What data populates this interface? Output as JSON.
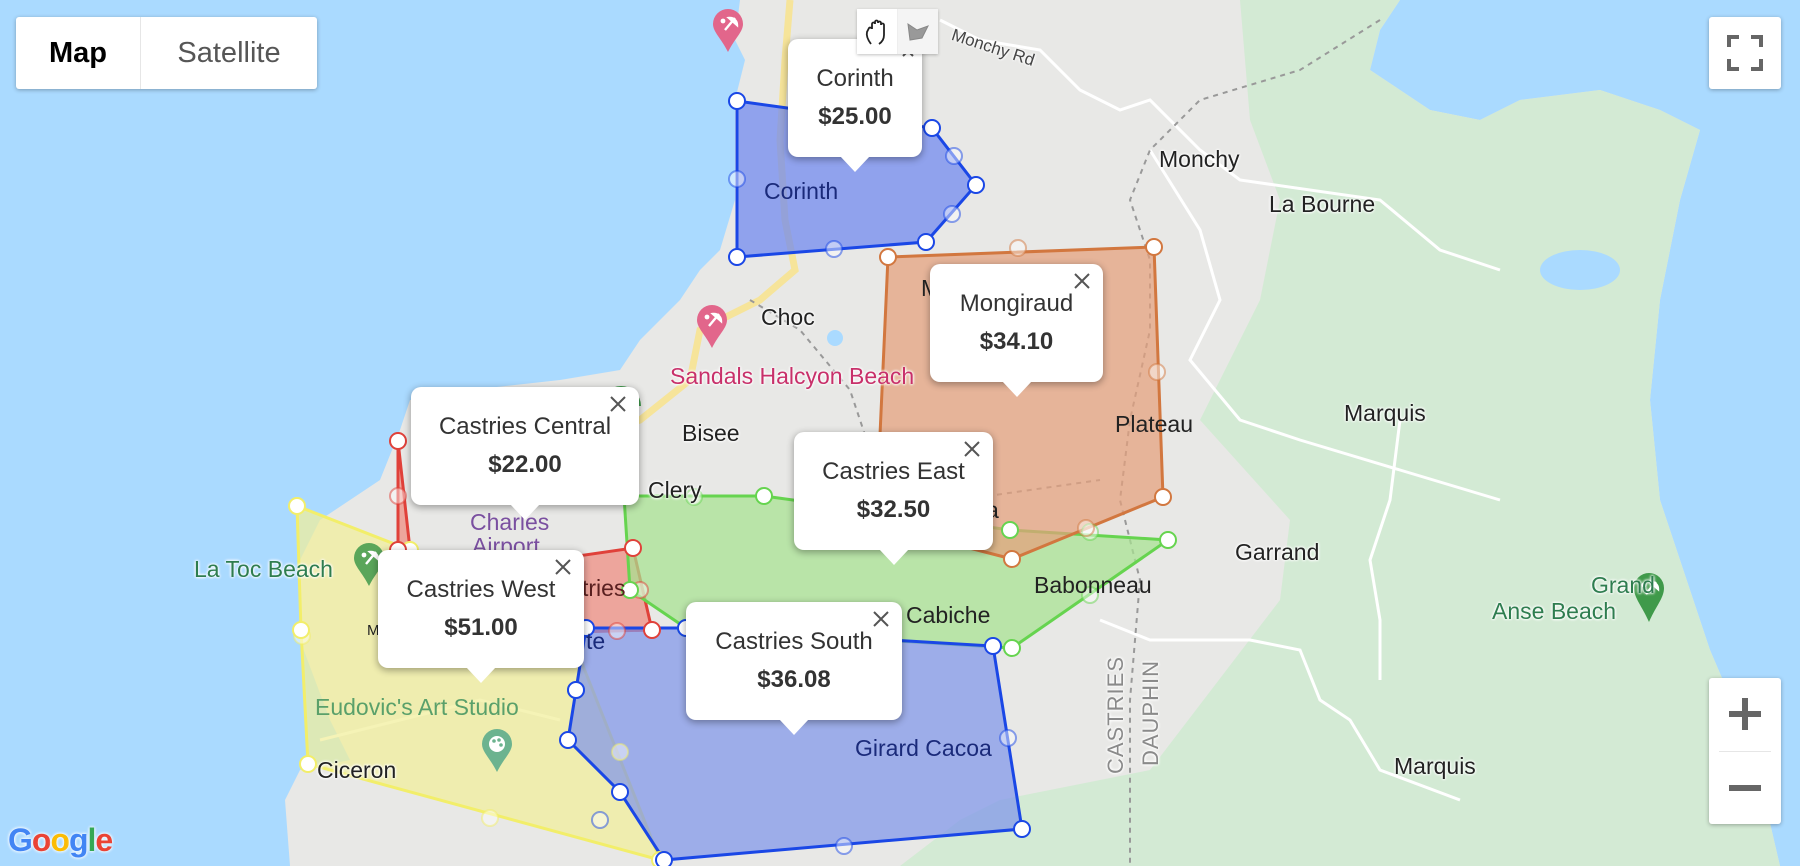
{
  "map_type": {
    "options": [
      "Map",
      "Satellite"
    ],
    "selected": "Map"
  },
  "controls": {
    "fullscreen": "fullscreen-icon",
    "zoom_in": "+",
    "zoom_out": "−",
    "drawing_tools": [
      "hand-pan-icon",
      "polygon-draw-icon"
    ]
  },
  "attribution": {
    "logo_letters": [
      "G",
      "o",
      "o",
      "g",
      "l",
      "e"
    ],
    "logo_colors": [
      "#4285f4",
      "#ea4335",
      "#fbbc05",
      "#4285f4",
      "#34a853",
      "#ea4335"
    ]
  },
  "zones": [
    {
      "name": "Corinth",
      "price": "$25.00",
      "color": "#1a47e6",
      "fill": "#6e86f0"
    },
    {
      "name": "Mongiraud",
      "price": "$34.10",
      "color": "#d2773f",
      "fill": "#e4a07c"
    },
    {
      "name": "Castries Central",
      "price": "$22.00",
      "color": "#e0413a",
      "fill": "#ef8b80"
    },
    {
      "name": "Castries East",
      "price": "$32.50",
      "color": "#66d44f",
      "fill": "#a6e290"
    },
    {
      "name": "Castries West",
      "price": "$51.00",
      "color": "#f2ee6a",
      "fill": "#f1ee9a"
    },
    {
      "name": "Castries South",
      "price": "$36.08",
      "color": "#1a47e6",
      "fill": "#7f95ea"
    }
  ],
  "place_labels": {
    "monchy_rd": "Monchy Rd",
    "monchy": "Monchy",
    "la_bourne": "La Bourne",
    "corinth": "Corinth",
    "choc": "Choc",
    "sandals": "Sandals Halcyon Beach",
    "bisee": "Bisee",
    "clery": "Clery",
    "plateau": "Plateau",
    "marquis_n": "Marquis",
    "marquis_s": "Marquis",
    "garrand": "Garrand",
    "babonneau": "Babonneau",
    "cabiche": "Cabiche",
    "girard_cacoa": "Girard Cacoa",
    "grand_anse_1": "Grand",
    "grand_anse_2": "Anse Beach",
    "la_toc": "La Toc Beach",
    "charles_airport_1": "Charles",
    "charles_airport_2": "Airport",
    "castries_frag": "tries",
    "eudovic": "Eudovic's Art Studio",
    "ciceron": "Ciceron",
    "castries_vert": "CASTRIES",
    "dauphin_vert": "DAUPHIN",
    "a_frag": "a",
    "m_frag": "M",
    "te_frag": "te"
  }
}
